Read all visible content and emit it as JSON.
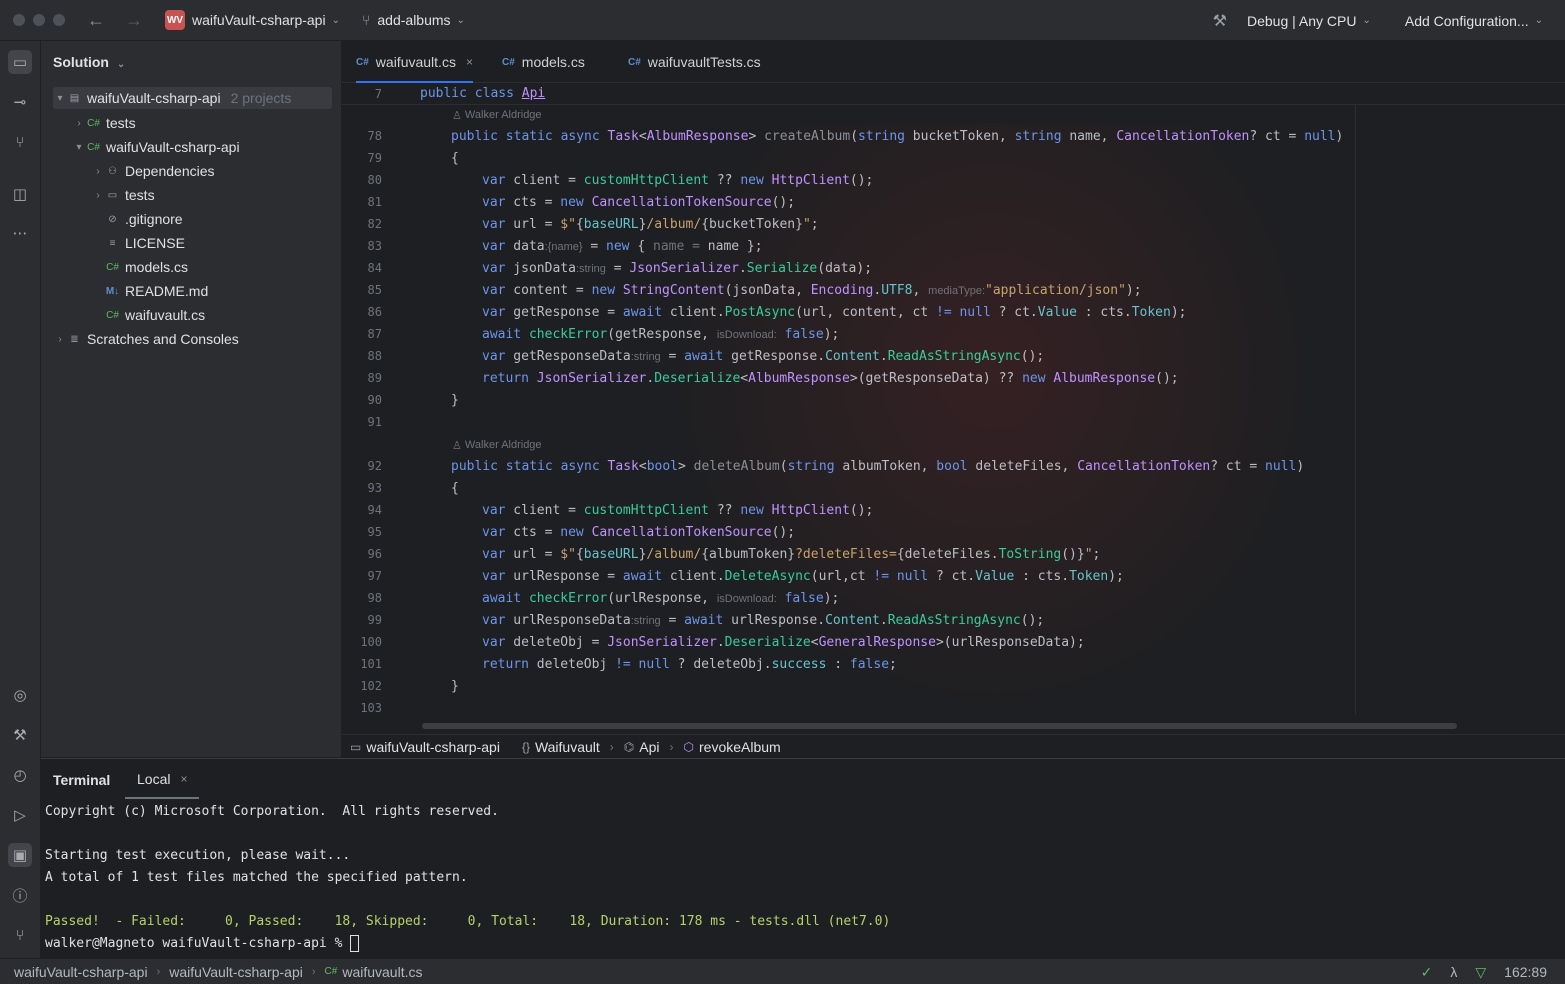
{
  "titlebar": {
    "project_badge": "WV",
    "project_name": "waifuVault-csharp-api",
    "branch": "add-albums",
    "run_config": "Debug | Any CPU",
    "add_config": "Add Configuration..."
  },
  "project_panel": {
    "title": "Solution",
    "root": {
      "label": "waifuVault-csharp-api",
      "meta": "2 projects"
    },
    "items": [
      {
        "label": "tests",
        "icon": "C#"
      },
      {
        "label": "waifuVault-csharp-api",
        "icon": "C#"
      },
      {
        "label": "Dependencies",
        "icon": "deps"
      },
      {
        "label": "tests",
        "icon": "folder"
      },
      {
        "label": ".gitignore",
        "icon": "ignore"
      },
      {
        "label": "LICENSE",
        "icon": "text"
      },
      {
        "label": "models.cs",
        "icon": "C#"
      },
      {
        "label": "README.md",
        "icon": "M↓"
      },
      {
        "label": "waifuvault.cs",
        "icon": "C#"
      },
      {
        "label": "Scratches and Consoles",
        "icon": "scratch"
      }
    ]
  },
  "tabs": [
    {
      "label": "waifuvault.cs",
      "icon": "C#"
    },
    {
      "label": "models.cs",
      "icon": "C#"
    },
    {
      "label": "waifuvaultTests.cs",
      "icon": "C#"
    }
  ],
  "editor": {
    "sticky": {
      "num": "7",
      "kw": "public class ",
      "name": "Api"
    },
    "author": "Walker Aldridge",
    "lines": [
      {
        "n": "78"
      },
      {
        "n": "79"
      },
      {
        "n": "80"
      },
      {
        "n": "81"
      },
      {
        "n": "82"
      },
      {
        "n": "83"
      },
      {
        "n": "84"
      },
      {
        "n": "85"
      },
      {
        "n": "86"
      },
      {
        "n": "87"
      },
      {
        "n": "88"
      },
      {
        "n": "89"
      },
      {
        "n": "90"
      },
      {
        "n": "91"
      },
      {
        "n": "92"
      },
      {
        "n": "93"
      },
      {
        "n": "94"
      },
      {
        "n": "95"
      },
      {
        "n": "96"
      },
      {
        "n": "97"
      },
      {
        "n": "98"
      },
      {
        "n": "99"
      },
      {
        "n": "100"
      },
      {
        "n": "101"
      },
      {
        "n": "102"
      },
      {
        "n": "103"
      }
    ]
  },
  "breadcrumbs": [
    "waifuVault-csharp-api",
    "Waifuvault",
    "Api",
    "revokeAlbum"
  ],
  "terminal": {
    "title": "Terminal",
    "tab": "Local",
    "lines": [
      "Copyright (c) Microsoft Corporation.  All rights reserved.",
      "",
      "Starting test execution, please wait...",
      "A total of 1 test files matched the specified pattern.",
      "",
      "Passed!  - Failed:     0, Passed:    18, Skipped:     0, Total:    18, Duration: 178 ms - tests.dll (net7.0)",
      "walker@Magneto waifuVault-csharp-api % "
    ]
  },
  "statusbar": {
    "path": [
      "waifuVault-csharp-api",
      "waifuVault-csharp-api",
      "waifuvault.cs"
    ],
    "position": "162:89"
  }
}
